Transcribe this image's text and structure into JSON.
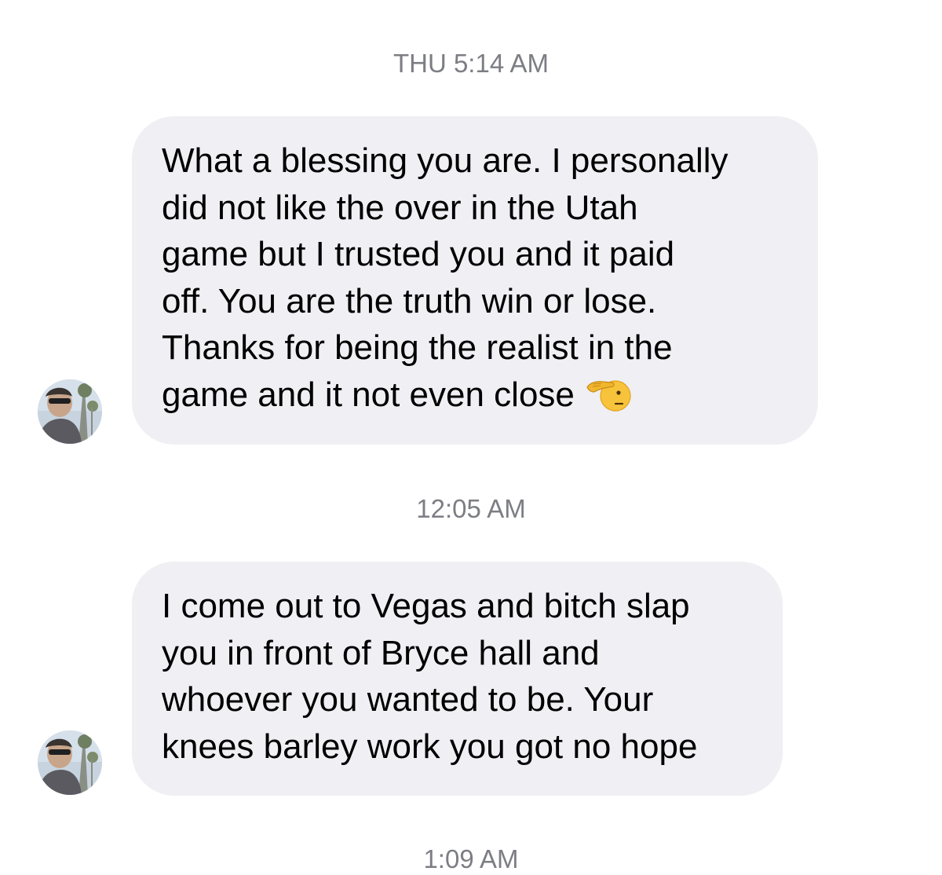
{
  "conversation": {
    "messages": [
      {
        "timestamp": "THU 5:14 AM",
        "text": "What a blessing you are. I personally\ndid not like the over in the Utah\ngame but I trusted you and it paid\noff. You are the truth win or lose.\nThanks for being the realist in the\ngame and it not even close",
        "trailing_icon": "saluting-face-emoji",
        "avatar": "sender-avatar"
      },
      {
        "timestamp": "12:05 AM",
        "text": "I come out to Vegas and bitch slap\nyou in front of Bryce hall and\nwhoever you wanted to be. Your\nknees barley work you got no hope",
        "avatar": "sender-avatar"
      }
    ],
    "trailing_timestamp": "1:09 AM"
  },
  "colors": {
    "bubble_background": "#efeff4",
    "timestamp_text": "#7d7e84",
    "message_text": "#000000"
  }
}
